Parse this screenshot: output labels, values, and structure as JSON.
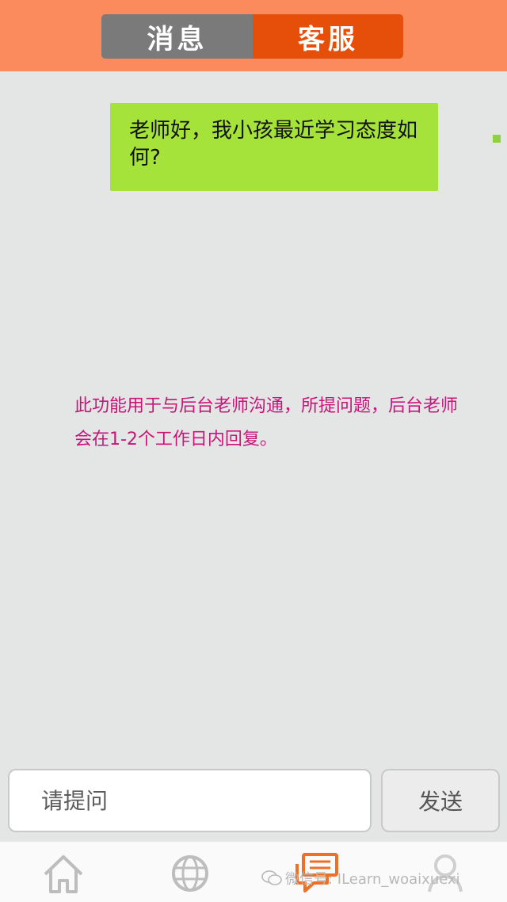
{
  "header": {
    "tabs": [
      {
        "label": "消息",
        "active": false
      },
      {
        "label": "客服",
        "active": true
      }
    ],
    "colors": {
      "bar": "#fb8a5d",
      "active_tab": "#e64f0a",
      "inactive_tab": "#7a7a7a"
    }
  },
  "chat": {
    "messages": [
      {
        "text": "老师好，我小孩最近学习态度如何?",
        "sender": "self"
      }
    ],
    "notice": "此功能用于与后台老师沟通，所提问题，后台老师会在1-2个工作日内回复。"
  },
  "composer": {
    "placeholder": "请提问",
    "send_label": "发送"
  },
  "tabbar": {
    "items": [
      {
        "icon": "home-icon"
      },
      {
        "icon": "globe-icon"
      },
      {
        "icon": "chat-icon",
        "active": true
      },
      {
        "icon": "user-icon"
      }
    ]
  },
  "watermark": "微信号: ILearn_woaixuexi"
}
